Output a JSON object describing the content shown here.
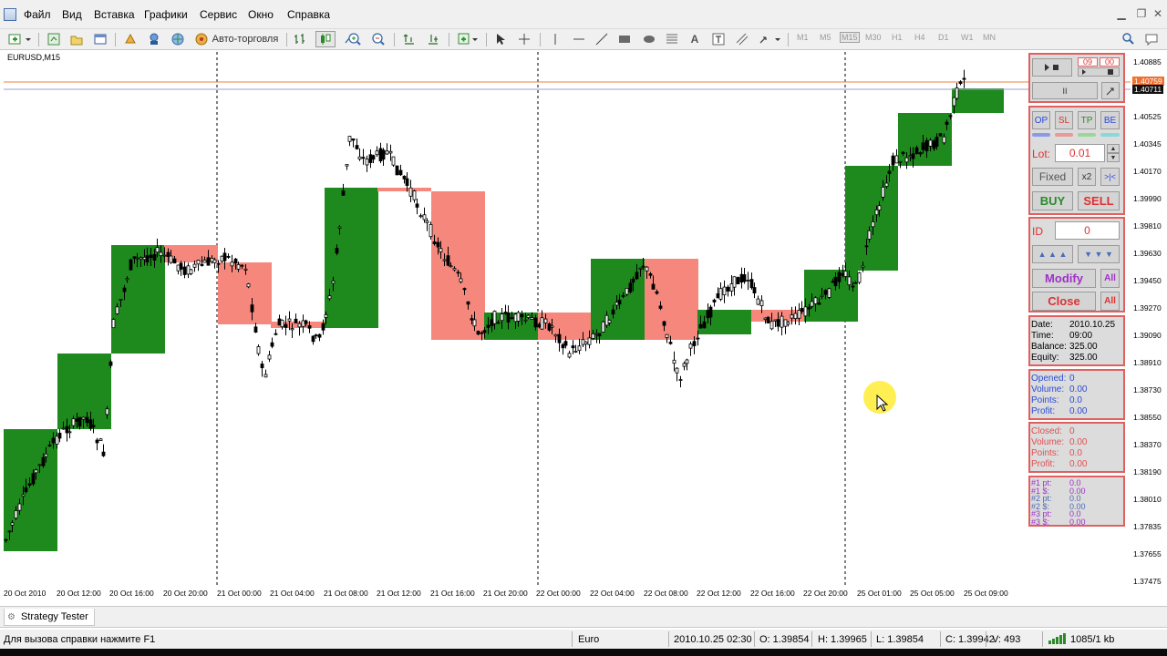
{
  "menu": {
    "items": [
      "Файл",
      "Вид",
      "Вставка",
      "Графики",
      "Сервис",
      "Окно",
      "Справка"
    ]
  },
  "toolbar": {
    "autotrade_label": "Авто-торговля",
    "timeframes": [
      "M1",
      "M5",
      "M15",
      "M30",
      "H1",
      "H4",
      "D1",
      "W1",
      "MN"
    ],
    "active_timeframe": "M15"
  },
  "chart": {
    "symbol": "EURUSD,M15",
    "price_labels": [
      "1.40885",
      "1.40525",
      "1.40345",
      "1.40170",
      "1.39990",
      "1.39810",
      "1.39630",
      "1.39450",
      "1.39270",
      "1.39090",
      "1.38910",
      "1.38730",
      "1.38550",
      "1.38370",
      "1.38190",
      "1.38010",
      "1.37835",
      "1.37655",
      "1.37475"
    ],
    "ask_tag": "1.40759",
    "bid_tag": "1.40711",
    "time_labels": [
      "20 Oct 2010",
      "20 Oct 12:00",
      "20 Oct 16:00",
      "20 Oct 20:00",
      "21 Oct 00:00",
      "21 Oct 04:00",
      "21 Oct 08:00",
      "21 Oct 12:00",
      "21 Oct 16:00",
      "21 Oct 20:00",
      "22 Oct 00:00",
      "22 Oct 04:00",
      "22 Oct 08:00",
      "22 Oct 12:00",
      "22 Oct 16:00",
      "22 Oct 20:00",
      "25 Oct 01:00",
      "25 Oct 05:00",
      "25 Oct 09:00"
    ],
    "colors": {
      "bull_box": "#1e8a1e",
      "bear_box": "#f5877c",
      "candle": "#000000",
      "ask_line": "#f08040",
      "bid_line": "#9aa0c8"
    }
  },
  "panel": {
    "timer_hh": "09",
    "timer_mm": "00",
    "pause_label": "II",
    "op_label": "OP",
    "sl_label": "SL",
    "tp_label": "TP",
    "be_label": "BE",
    "lot_label": "Lot:",
    "lot_value": "0.01",
    "fixed_label": "Fixed",
    "x2_label": "x2",
    "split_label": ">|<",
    "buy_label": "BUY",
    "sell_label": "SELL",
    "id_label": "ID",
    "id_value": "0",
    "up_label": "▲ ▲ ▲",
    "down_label": "▼ ▼ ▼",
    "modify_label": "Modify",
    "all_label": "All",
    "close_label": "Close",
    "account": {
      "date_k": "Date:",
      "date_v": "2010.10.25",
      "time_k": "Time:",
      "time_v": "09:00",
      "balance_k": "Balance:",
      "balance_v": "325.00",
      "equity_k": "Equity:",
      "equity_v": "325.00"
    },
    "opened": {
      "opened_k": "Opened:",
      "opened_v": "0",
      "volume_k": "Volume:",
      "volume_v": "0.00",
      "points_k": "Points:",
      "points_v": "0.0",
      "profit_k": "Profit:",
      "profit_v": "0.00"
    },
    "closed": {
      "closed_k": "Closed:",
      "closed_v": "0",
      "volume_k": "Volume:",
      "volume_v": "0.00",
      "points_k": "Points:",
      "points_v": "0.0",
      "profit_k": "Profit:",
      "profit_v": "0.00"
    },
    "stats": {
      "r1k": "#1 pt:",
      "r1v": "0.0",
      "r2k": "#1 $:",
      "r2v": "0.00",
      "r3k": "#2 pt:",
      "r3v": "0.0",
      "r4k": "#2 $:",
      "r4v": "0.00",
      "r5k": "#3 pt:",
      "r5v": "0.0",
      "r6k": "#3 $:",
      "r6v": "0.00"
    }
  },
  "tabs": {
    "strategy_tester": "Strategy Tester"
  },
  "status": {
    "help": "Для вызова справки нажмите F1",
    "profile": "Euro",
    "datetime": "2010.10.25 02:30",
    "open": "O: 1.39854",
    "high": "H: 1.39965",
    "low": "L: 1.39854",
    "close": "C: 1.39942",
    "volume": "V: 493",
    "traffic": "1085/1 kb"
  }
}
